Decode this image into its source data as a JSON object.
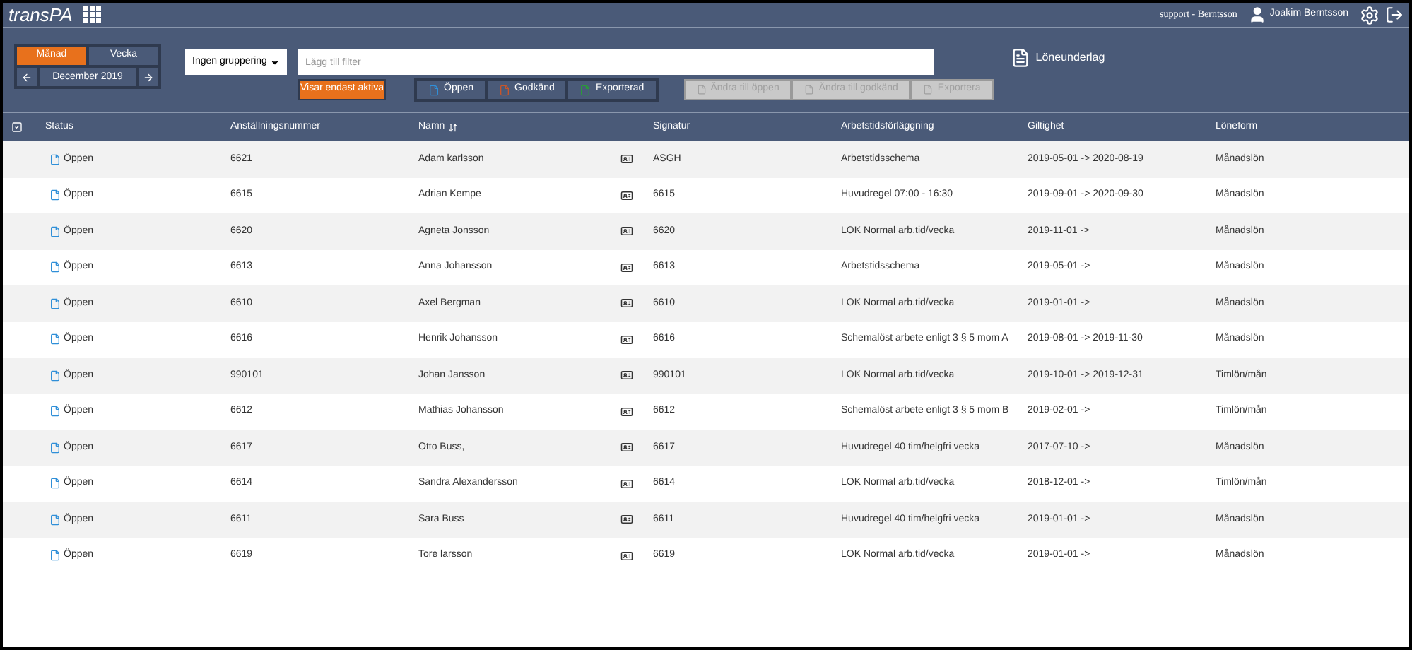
{
  "topbar": {
    "logo": "transPA",
    "account": "support - Berntsson",
    "user": "Joakim Berntsson"
  },
  "period": {
    "tabs": [
      {
        "label": "Månad",
        "selected": true
      },
      {
        "label": "Vecka",
        "selected": false
      }
    ],
    "label": "December 2019"
  },
  "grouping": {
    "value": "Ingen gruppering"
  },
  "filter": {
    "placeholder": "Lägg till filter"
  },
  "active_toggle": {
    "label": "Visar endast aktiva",
    "on": true
  },
  "status_filters": [
    {
      "label": "Öppen",
      "color": "#2f8fd8"
    },
    {
      "label": "Godkänd",
      "color": "#c8552a"
    },
    {
      "label": "Exporterad",
      "color": "#2a9a3a"
    }
  ],
  "actions": [
    {
      "label": "Ändra till öppen",
      "disabled": true
    },
    {
      "label": "Ändra till godkänd",
      "disabled": true
    },
    {
      "label": "Exportera",
      "disabled": true
    }
  ],
  "payroll_link": "Löneunderlag",
  "table": {
    "all_checked": true,
    "columns": [
      "Status",
      "Anställningsnummer",
      "Namn",
      "Signatur",
      "Arbetstidsförläggning",
      "Giltighet",
      "Löneform"
    ],
    "rows": [
      {
        "status": "Öppen",
        "number": "6621",
        "name": "Adam karlsson",
        "signature": "ASGH",
        "schedule": "Arbetstidsschema",
        "validity": "2019-05-01 -> 2020-08-19",
        "pay": "Månadslön"
      },
      {
        "status": "Öppen",
        "number": "6615",
        "name": "Adrian Kempe",
        "signature": "6615",
        "schedule": "Huvudregel 07:00 - 16:30",
        "validity": "2019-09-01 -> 2020-09-30",
        "pay": "Månadslön"
      },
      {
        "status": "Öppen",
        "number": "6620",
        "name": "Agneta Jonsson",
        "signature": "6620",
        "schedule": "LOK Normal arb.tid/vecka",
        "validity": "2019-11-01 ->",
        "pay": "Månadslön"
      },
      {
        "status": "Öppen",
        "number": "6613",
        "name": "Anna Johansson",
        "signature": "6613",
        "schedule": "Arbetstidsschema",
        "validity": "2019-05-01 ->",
        "pay": "Månadslön"
      },
      {
        "status": "Öppen",
        "number": "6610",
        "name": "Axel Bergman",
        "signature": "6610",
        "schedule": "LOK Normal arb.tid/vecka",
        "validity": "2019-01-01 ->",
        "pay": "Månadslön"
      },
      {
        "status": "Öppen",
        "number": "6616",
        "name": "Henrik Johansson",
        "signature": "6616",
        "schedule": "Schemalöst arbete enligt 3 § 5 mom A",
        "validity": "2019-08-01 -> 2019-11-30",
        "pay": "Månadslön"
      },
      {
        "status": "Öppen",
        "number": "990101",
        "name": "Johan Jansson",
        "signature": "990101",
        "schedule": "LOK Normal arb.tid/vecka",
        "validity": "2019-10-01 -> 2019-12-31",
        "pay": "Timlön/mån"
      },
      {
        "status": "Öppen",
        "number": "6612",
        "name": "Mathias Johansson",
        "signature": "6612",
        "schedule": "Schemalöst arbete enligt 3 § 5 mom B",
        "validity": "2019-02-01 ->",
        "pay": "Timlön/mån"
      },
      {
        "status": "Öppen",
        "number": "6617",
        "name": "Otto Buss,",
        "signature": "6617",
        "schedule": "Huvudregel 40 tim/helgfri vecka",
        "validity": "2017-07-10 ->",
        "pay": "Månadslön"
      },
      {
        "status": "Öppen",
        "number": "6614",
        "name": "Sandra Alexandersson",
        "signature": "6614",
        "schedule": "LOK Normal arb.tid/vecka",
        "validity": "2018-12-01 ->",
        "pay": "Timlön/mån"
      },
      {
        "status": "Öppen",
        "number": "6611",
        "name": "Sara Buss",
        "signature": "6611",
        "schedule": "Huvudregel 40 tim/helgfri vecka",
        "validity": "2019-01-01 ->",
        "pay": "Månadslön"
      },
      {
        "status": "Öppen",
        "number": "6619",
        "name": "Tore larsson",
        "signature": "6619",
        "schedule": "LOK Normal arb.tid/vecka",
        "validity": "2019-01-01 ->",
        "pay": "Månadslön"
      }
    ]
  }
}
